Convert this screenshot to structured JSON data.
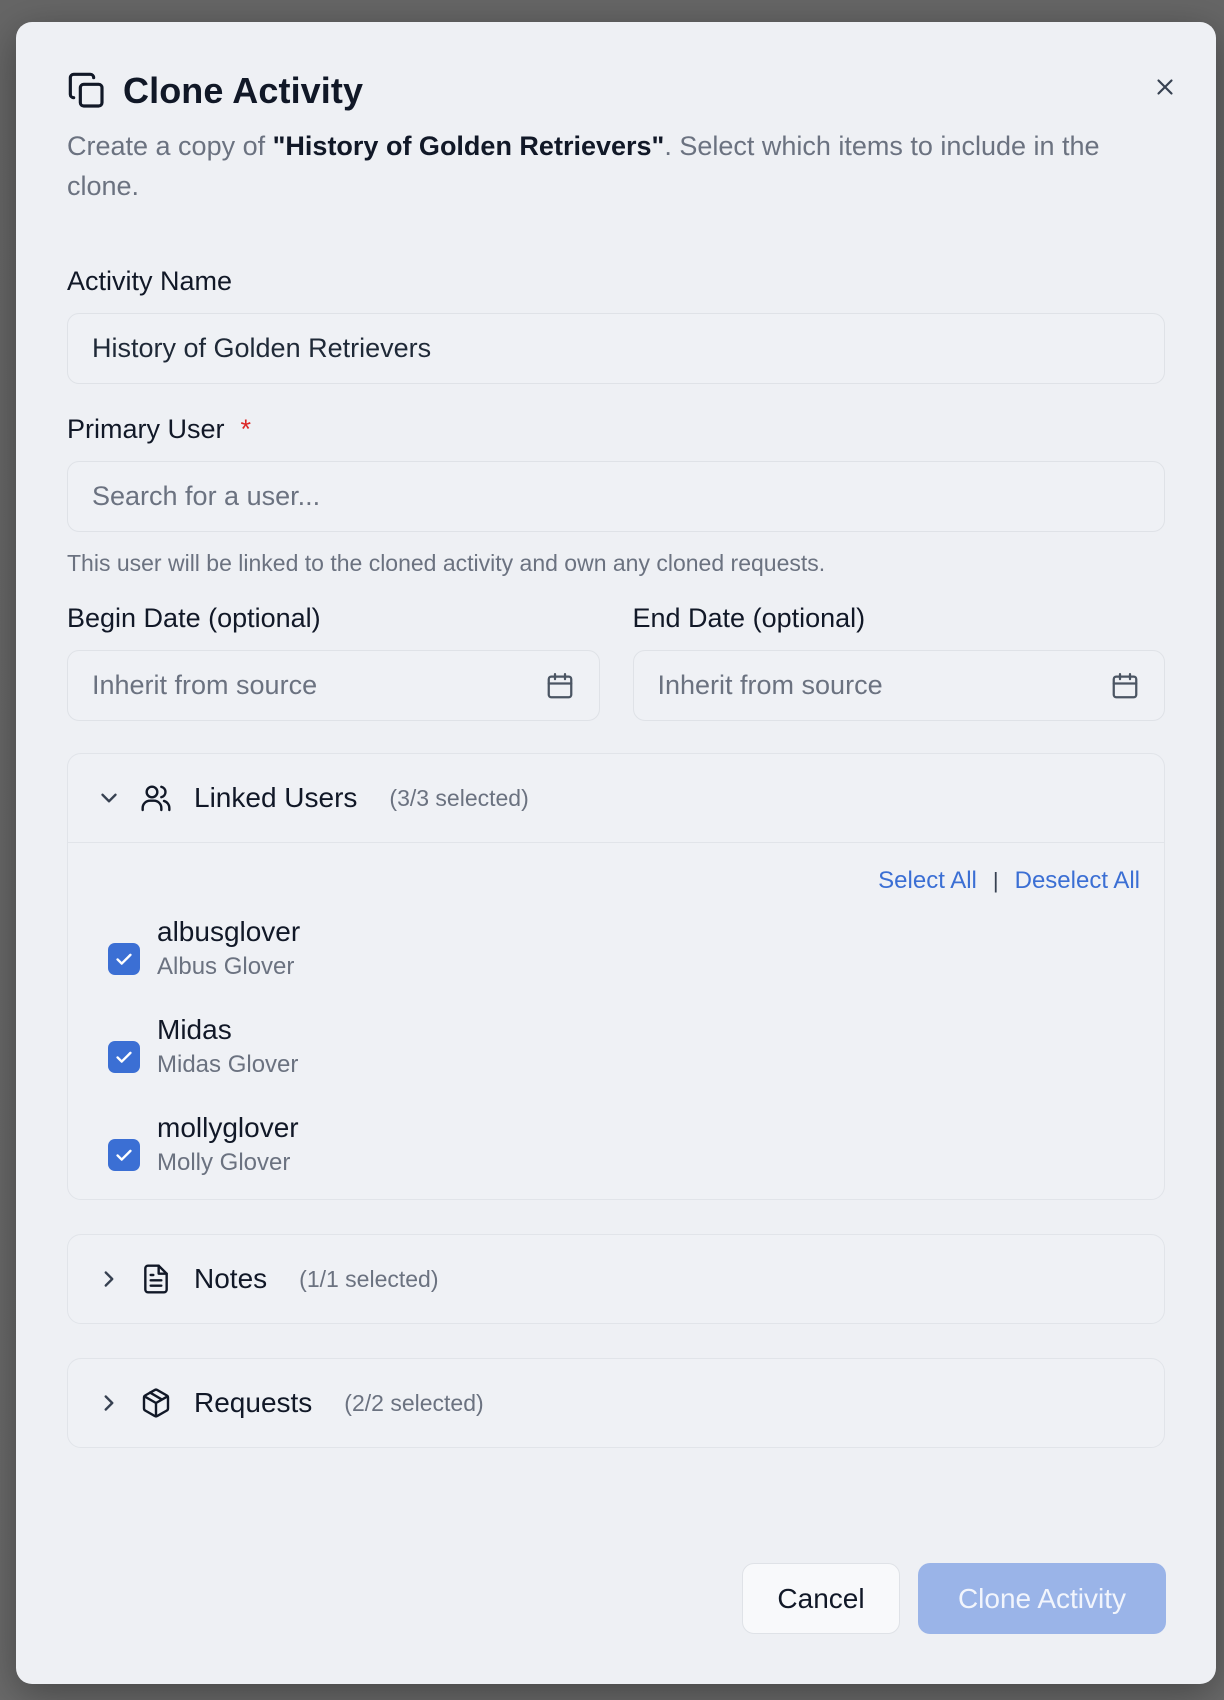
{
  "dialog": {
    "title": "Clone Activity",
    "description_prefix": "Create a copy of ",
    "description_activity": "\"History of Golden Retrievers\"",
    "description_suffix": ". Select which items to include in the clone."
  },
  "activity_name": {
    "label": "Activity Name",
    "value": "History of Golden Retrievers"
  },
  "primary_user": {
    "label": "Primary User",
    "required_marker": "*",
    "placeholder": "Search for a user...",
    "hint": "This user will be linked to the cloned activity and own any cloned requests."
  },
  "begin_date": {
    "label": "Begin Date (optional)",
    "placeholder": "Inherit from source"
  },
  "end_date": {
    "label": "End Date (optional)",
    "placeholder": "Inherit from source"
  },
  "linked_users": {
    "title": "Linked Users",
    "count": "(3/3 selected)",
    "select_all": "Select All",
    "separator": "|",
    "deselect_all": "Deselect All",
    "users": [
      {
        "username": "albusglover",
        "full_name": "Albus Glover",
        "checked": true
      },
      {
        "username": "Midas",
        "full_name": "Midas Glover",
        "checked": true
      },
      {
        "username": "mollyglover",
        "full_name": "Molly Glover",
        "checked": true
      }
    ]
  },
  "notes": {
    "title": "Notes",
    "count": "(1/1 selected)"
  },
  "requests": {
    "title": "Requests",
    "count": "(2/2 selected)"
  },
  "footer": {
    "cancel_label": "Cancel",
    "clone_label": "Clone Activity"
  },
  "colors": {
    "accent": "#3b6fd4",
    "disabled_primary": "#9ab4e8",
    "required": "#dc2626"
  },
  "icons": {
    "header": "copy-icon",
    "close": "close-icon",
    "date": "calendar-icon",
    "linked_users": "users-icon",
    "notes": "file-text-icon",
    "requests": "package-icon"
  }
}
